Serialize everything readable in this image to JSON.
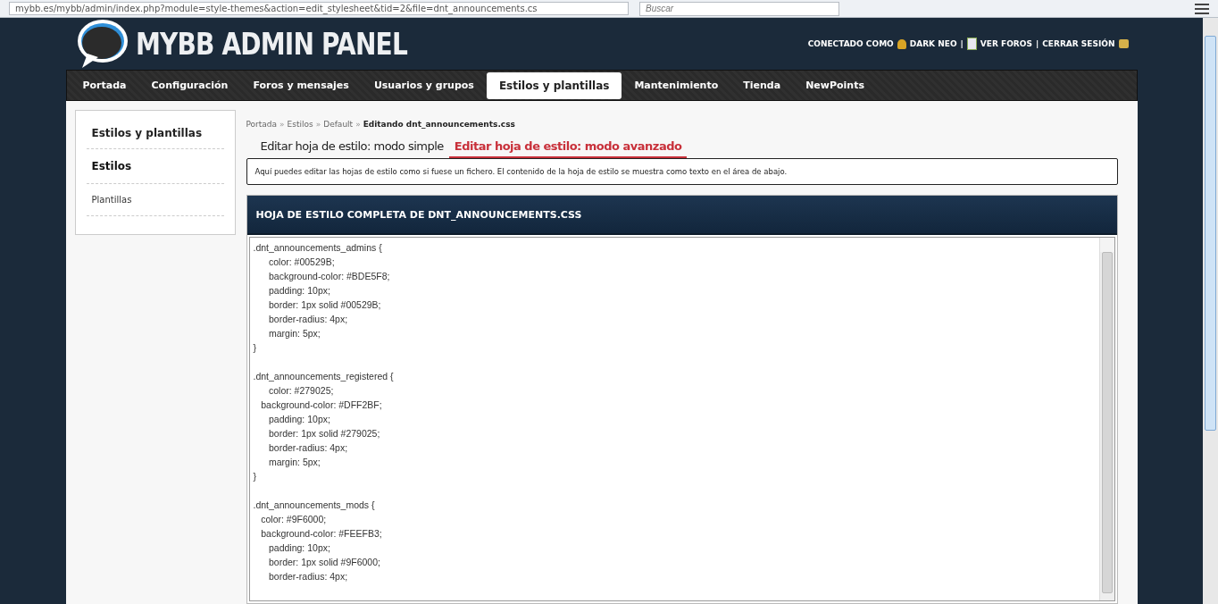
{
  "browser": {
    "url": "mybb.es/mybb/admin/index.php?module=style-themes&action=edit_stylesheet&tid=2&file=dnt_announcements.cs",
    "search": {
      "placeholder": "Buscar"
    }
  },
  "header": {
    "logo": "MYBB ADMIN PANEL",
    "user_label": "CONECTADO COMO",
    "user": "DARK NEO",
    "user_separator": "|",
    "view_forums": "VER FOROS",
    "forums_separator": "|",
    "logout": "CERRAR SESIÓN"
  },
  "nav": [
    {
      "label": "Portada",
      "selected": false
    },
    {
      "label": "Configuración",
      "selected": false
    },
    {
      "label": "Foros y mensajes",
      "selected": false
    },
    {
      "label": "Usuarios y grupos",
      "selected": false
    },
    {
      "label": "Estilos y plantillas",
      "selected": true
    },
    {
      "label": "Mantenimiento",
      "selected": false
    },
    {
      "label": "Tienda",
      "selected": false
    },
    {
      "label": "NewPoints",
      "selected": false
    }
  ],
  "sidebar": {
    "title": "Estilos y plantillas",
    "items": [
      {
        "label": "Estilos",
        "selected": true
      },
      {
        "label": "Plantillas",
        "selected": false
      }
    ]
  },
  "breadcrumb": [
    {
      "label": "Portada",
      "separator": "»"
    },
    {
      "label": "Estilos",
      "separator": "»"
    },
    {
      "label": "Default",
      "separator": "»"
    }
  ],
  "breadcrumb_current": "Editando dnt_announcements.css",
  "tabs": [
    {
      "label": "Editar hoja de estilo: modo simple",
      "selected": false
    },
    {
      "label": "Editar hoja de estilo: modo avanzado",
      "selected": true
    }
  ],
  "notice": "Aquí puedes editar las hojas de estilo como si fuese un fichero. El contenido de la hoja de estilo se muestra como texto en el área de abajo.",
  "editor": {
    "title": "HOJA DE ESTILO COMPLETA DE DNT_ANNOUNCEMENTS.CSS",
    "blocks": [
      {
        "lines": [
          ".dnt_announcements_admins {",
          "      color: #00529B;",
          "      background-color: #BDE5F8;",
          "      padding: 10px;",
          "      border: 1px solid #00529B;",
          "      border-radius: 4px;",
          "      margin: 5px;",
          "}"
        ]
      },
      {
        "lines": [
          ".dnt_announcements_registered {",
          "      color: #279025;",
          "   background-color: #DFF2BF;",
          "      padding: 10px;",
          "      border: 1px solid #279025;",
          "      border-radius: 4px;",
          "      margin: 5px;",
          "}"
        ]
      },
      {
        "lines": [
          ".dnt_announcements_mods {",
          "   color: #9F6000;",
          "   background-color: #FEEFB3;",
          "      padding: 10px;",
          "      border: 1px solid #9F6000;",
          "      border-radius: 4px;"
        ]
      }
    ]
  }
}
